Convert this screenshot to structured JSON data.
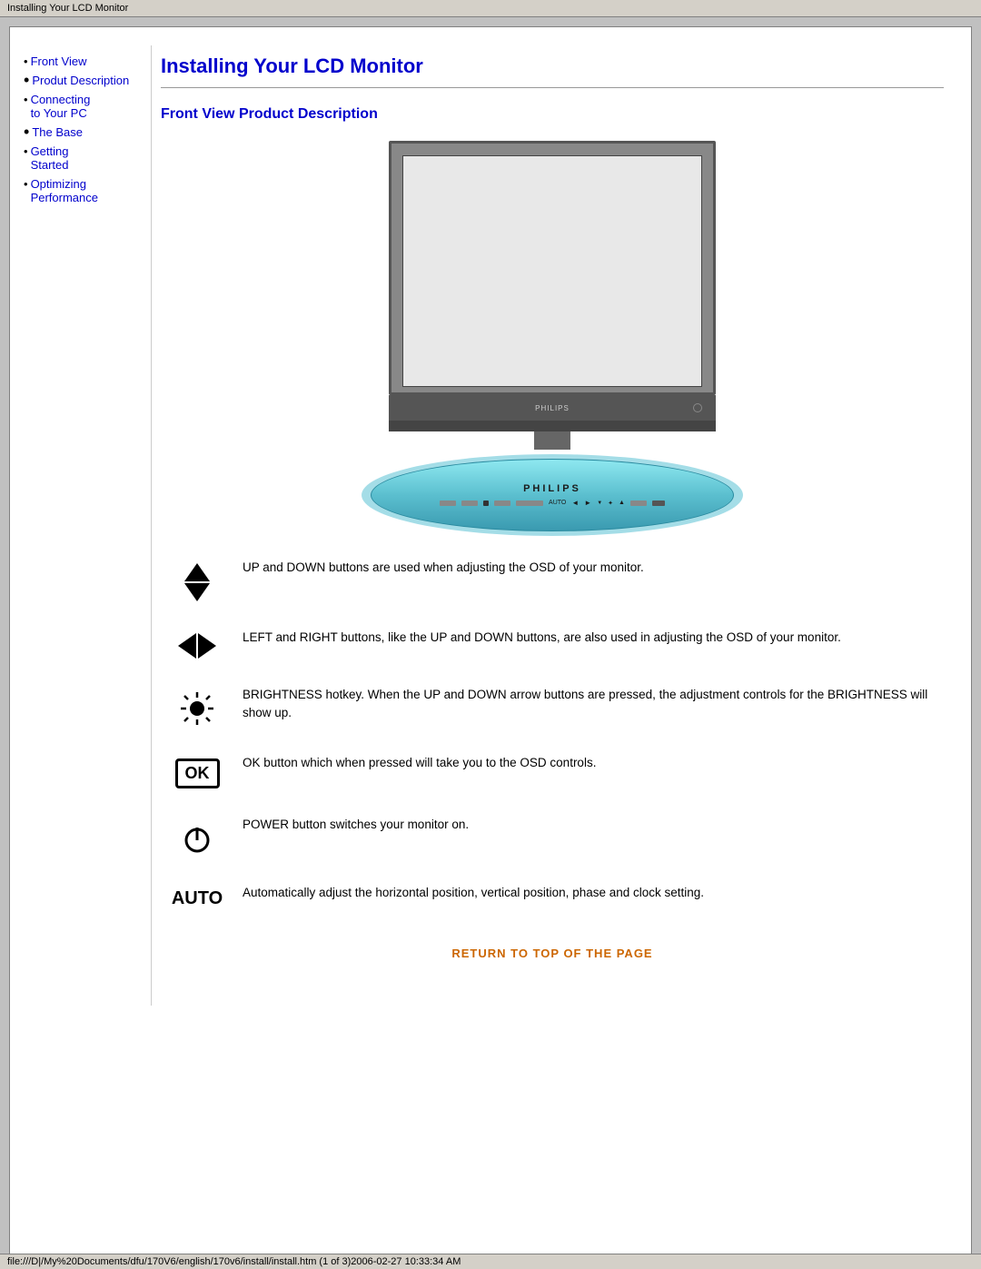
{
  "titleBar": {
    "text": "Installing Your LCD Monitor"
  },
  "sidebar": {
    "items": [
      {
        "label": "Front View",
        "hasBullet": false,
        "hasArrow": true
      },
      {
        "label": "Produt Description",
        "hasBullet": true,
        "hasArrow": false
      },
      {
        "label": "Connecting to Your PC",
        "hasBullet": false,
        "hasArrow": true
      },
      {
        "label": "The Base",
        "hasBullet": true,
        "hasArrow": false
      },
      {
        "label": "Getting Started",
        "hasBullet": false,
        "hasArrow": true
      },
      {
        "label": "Optimizing Performance",
        "hasBullet": false,
        "hasArrow": true
      }
    ]
  },
  "main": {
    "pageTitle": "Installing Your LCD Monitor",
    "sectionTitle": "Front View Product Description",
    "monitorBrand": "PHILIPS",
    "monitorOvalBrand": "PHILIPS",
    "features": [
      {
        "iconType": "updown",
        "text": "UP and DOWN buttons are used when adjusting the OSD of your monitor."
      },
      {
        "iconType": "leftright",
        "text": "LEFT and RIGHT buttons, like the UP and DOWN buttons, are also used in adjusting the OSD of your monitor."
      },
      {
        "iconType": "brightness",
        "text": "BRIGHTNESS hotkey. When the UP and DOWN arrow buttons are pressed, the adjustment controls for the BRIGHTNESS will show up."
      },
      {
        "iconType": "ok",
        "iconLabel": "OK",
        "text": "OK button which when pressed will take you to the OSD controls."
      },
      {
        "iconType": "power",
        "text": "POWER button switches your monitor on."
      },
      {
        "iconType": "auto",
        "iconLabel": "AUTO",
        "text": "Automatically adjust the horizontal position, vertical position, phase and clock setting."
      }
    ],
    "returnLink": "RETURN TO TOP OF THE PAGE"
  },
  "statusBar": {
    "text": "file:///D|/My%20Documents/dfu/170V6/english/170v6/install/install.htm (1 of 3)2006-02-27 10:33:34 AM"
  }
}
